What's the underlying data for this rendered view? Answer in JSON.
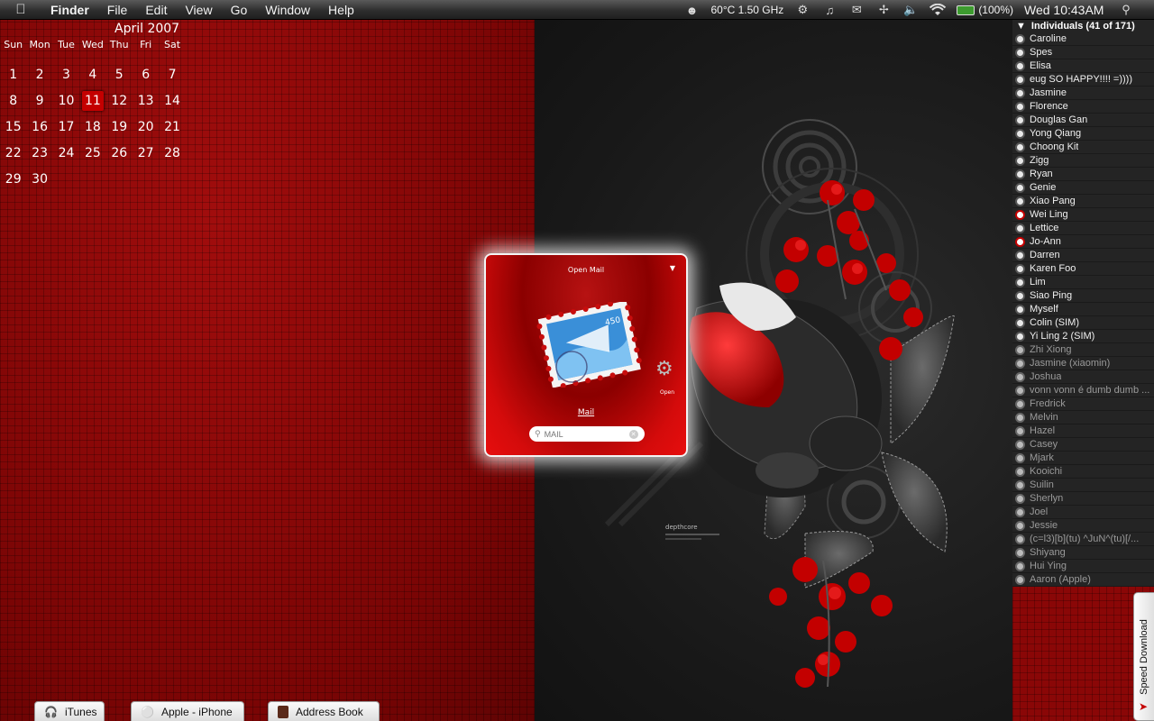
{
  "menubar": {
    "apple": "",
    "items": [
      "Finder",
      "File",
      "Edit",
      "View",
      "Go",
      "Window",
      "Help"
    ],
    "status": {
      "cpu": "60°C 1.50 GHz",
      "battery": "(100%)",
      "clock": "Wed 10:43AM"
    }
  },
  "calendar": {
    "title": "April 2007",
    "weekdays": [
      "Sun",
      "Mon",
      "Tue",
      "Wed",
      "Thu",
      "Fri",
      "Sat"
    ],
    "days": [
      "1",
      "2",
      "3",
      "4",
      "5",
      "6",
      "7",
      "8",
      "9",
      "10",
      "11",
      "12",
      "13",
      "14",
      "15",
      "16",
      "17",
      "18",
      "19",
      "20",
      "21",
      "22",
      "23",
      "24",
      "25",
      "26",
      "27",
      "28",
      "29",
      "30"
    ],
    "today": "11"
  },
  "buddy_list": {
    "group": "Individuals (41 of 171)",
    "buddies": [
      {
        "name": "Caroline",
        "status": "online"
      },
      {
        "name": "Spes",
        "status": "online"
      },
      {
        "name": "Elisa",
        "status": "online"
      },
      {
        "name": "eug SO HAPPY!!!! =))))",
        "status": "online"
      },
      {
        "name": "Jasmine",
        "status": "online"
      },
      {
        "name": "Florence",
        "status": "online"
      },
      {
        "name": "Douglas Gan",
        "status": "online"
      },
      {
        "name": "Yong Qiang",
        "status": "online"
      },
      {
        "name": "Choong Kit",
        "status": "online"
      },
      {
        "name": "Zigg",
        "status": "online"
      },
      {
        "name": "Ryan",
        "status": "online"
      },
      {
        "name": "Genie",
        "status": "online"
      },
      {
        "name": "Xiao Pang",
        "status": "online"
      },
      {
        "name": "Wei Ling",
        "status": "away"
      },
      {
        "name": "Lettice",
        "status": "online"
      },
      {
        "name": "Jo-Ann",
        "status": "away"
      },
      {
        "name": "Darren",
        "status": "online"
      },
      {
        "name": "Karen Foo",
        "status": "online"
      },
      {
        "name": "Lim",
        "status": "online"
      },
      {
        "name": "Siao Ping",
        "status": "online"
      },
      {
        "name": "Myself",
        "status": "online"
      },
      {
        "name": "Colin (SIM)",
        "status": "online"
      },
      {
        "name": "Yi Ling 2 (SIM)",
        "status": "online"
      },
      {
        "name": "Zhi Xiong",
        "status": "offline"
      },
      {
        "name": "Jasmine (xiaomin)",
        "status": "offline"
      },
      {
        "name": "Joshua",
        "status": "offline"
      },
      {
        "name": "vonn vonn é dumb dumb ...",
        "status": "offline"
      },
      {
        "name": "Fredrick",
        "status": "offline"
      },
      {
        "name": "Melvin",
        "status": "offline"
      },
      {
        "name": "Hazel",
        "status": "offline"
      },
      {
        "name": "Casey",
        "status": "offline"
      },
      {
        "name": "Mjark",
        "status": "offline"
      },
      {
        "name": "Kooichi",
        "status": "offline"
      },
      {
        "name": "Suilin",
        "status": "offline"
      },
      {
        "name": "Sherlyn",
        "status": "offline"
      },
      {
        "name": "Joel",
        "status": "offline"
      },
      {
        "name": "Jessie",
        "status": "offline"
      },
      {
        "name": "(c=l3)[b](tu) ^JuN^(tu)[/...",
        "status": "offline"
      },
      {
        "name": "Shiyang",
        "status": "offline"
      },
      {
        "name": "Hui Ying",
        "status": "offline"
      },
      {
        "name": "Aaron (Apple)",
        "status": "offline"
      }
    ]
  },
  "launcher": {
    "title": "Open Mail",
    "app_name": "Mail",
    "open_label": "Open",
    "search_placeholder": "MAIL",
    "stamp_value": "450"
  },
  "art": {
    "caption": "depthcore"
  },
  "minimized": [
    {
      "label": "iTunes",
      "icon": "headphones-icon"
    },
    {
      "label": "Apple - iPhone",
      "icon": "globe-icon"
    },
    {
      "label": "Address Book",
      "icon": "address-book-icon"
    }
  ],
  "speed_download": {
    "label": "Speed Download"
  },
  "colors": {
    "wallpaper_red": "#8a0707",
    "today_highlight": "#c40000",
    "away_red": "#c40000"
  }
}
